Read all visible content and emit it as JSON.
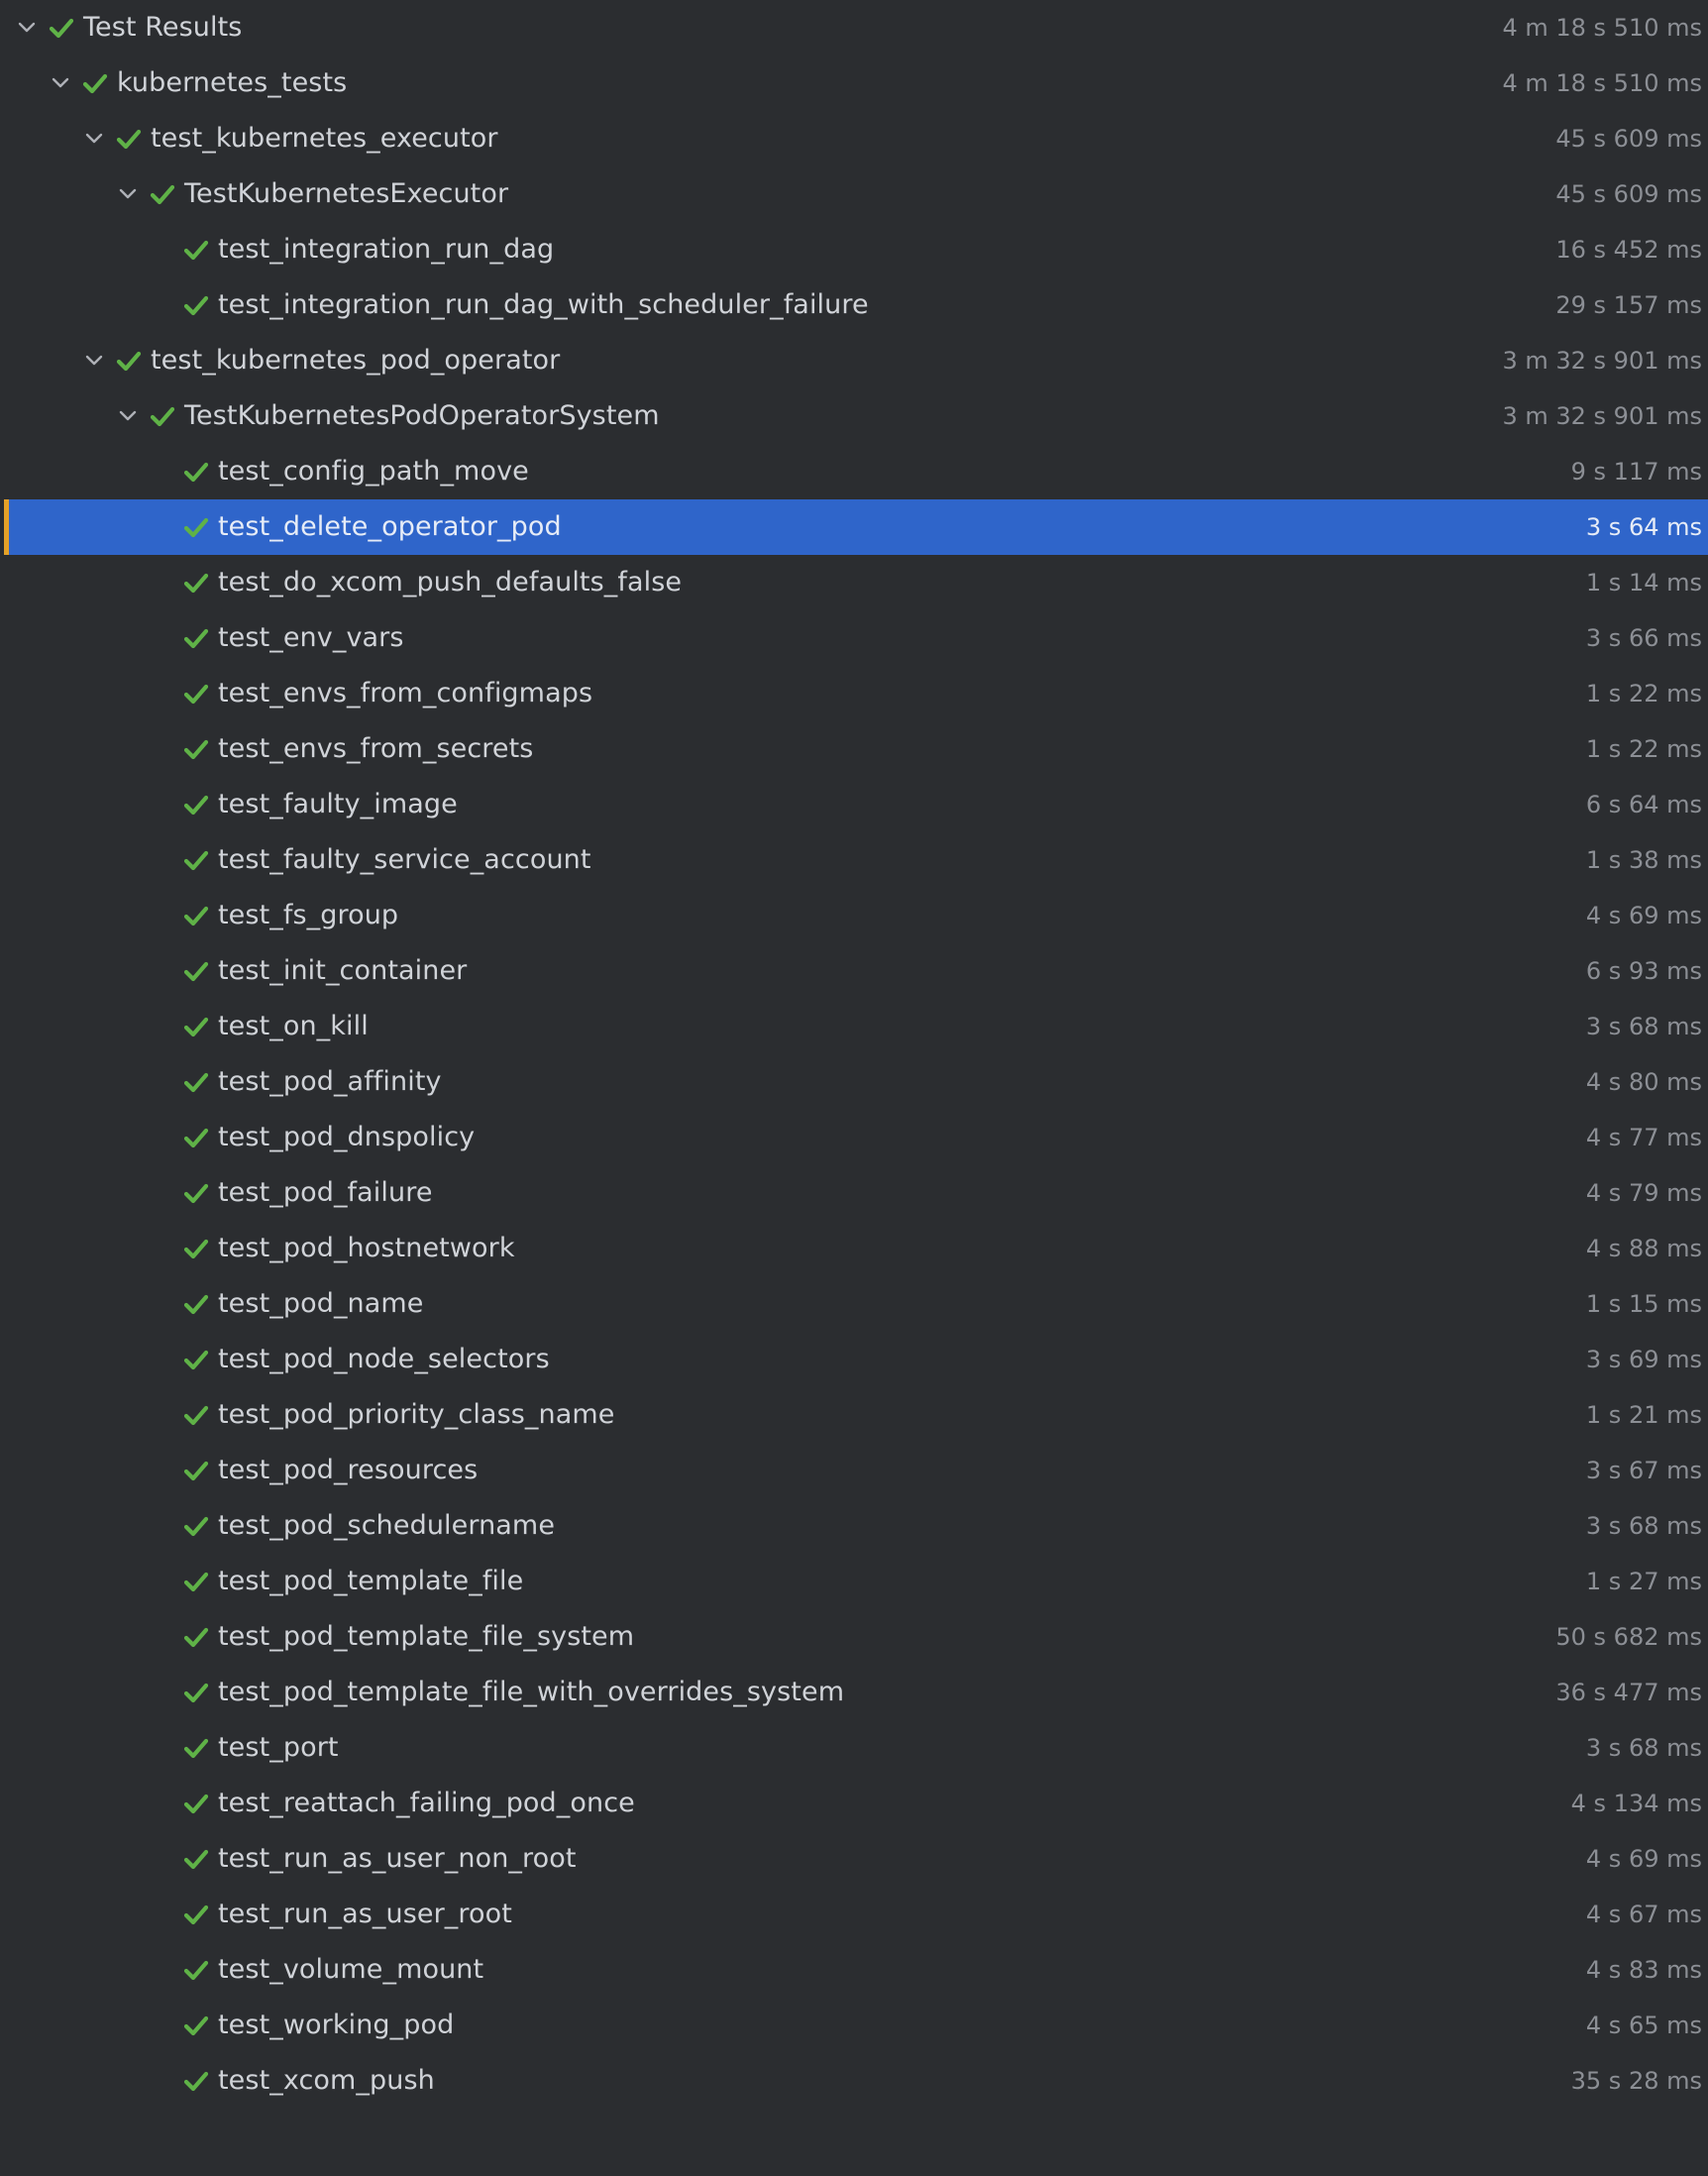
{
  "colors": {
    "background": "#2b2d30",
    "selected_row": "#2f65ca",
    "selected_marker": "#e5a228",
    "pass_check": "#5fb247",
    "text": "#d0d3d8",
    "duration_text": "#8c8f95"
  },
  "icons": {
    "expand": "chevron-down-icon",
    "status": "check-icon"
  },
  "tree": [
    {
      "label": "Test Results",
      "duration": "4 m 18 s 510 ms",
      "level": 0,
      "expanded": true,
      "selected": false,
      "status": "passed"
    },
    {
      "label": "kubernetes_tests",
      "duration": "4 m 18 s 510 ms",
      "level": 1,
      "expanded": true,
      "selected": false,
      "status": "passed"
    },
    {
      "label": "test_kubernetes_executor",
      "duration": "45 s 609 ms",
      "level": 2,
      "expanded": true,
      "selected": false,
      "status": "passed"
    },
    {
      "label": "TestKubernetesExecutor",
      "duration": "45 s 609 ms",
      "level": 3,
      "expanded": true,
      "selected": false,
      "status": "passed"
    },
    {
      "label": "test_integration_run_dag",
      "duration": "16 s 452 ms",
      "level": 4,
      "expanded": null,
      "selected": false,
      "status": "passed"
    },
    {
      "label": "test_integration_run_dag_with_scheduler_failure",
      "duration": "29 s 157 ms",
      "level": 4,
      "expanded": null,
      "selected": false,
      "status": "passed"
    },
    {
      "label": "test_kubernetes_pod_operator",
      "duration": "3 m 32 s 901 ms",
      "level": 2,
      "expanded": true,
      "selected": false,
      "status": "passed"
    },
    {
      "label": "TestKubernetesPodOperatorSystem",
      "duration": "3 m 32 s 901 ms",
      "level": 3,
      "expanded": true,
      "selected": false,
      "status": "passed"
    },
    {
      "label": "test_config_path_move",
      "duration": "9 s 117 ms",
      "level": 4,
      "expanded": null,
      "selected": false,
      "status": "passed"
    },
    {
      "label": "test_delete_operator_pod",
      "duration": "3 s 64 ms",
      "level": 4,
      "expanded": null,
      "selected": true,
      "status": "passed"
    },
    {
      "label": "test_do_xcom_push_defaults_false",
      "duration": "1 s 14 ms",
      "level": 4,
      "expanded": null,
      "selected": false,
      "status": "passed"
    },
    {
      "label": "test_env_vars",
      "duration": "3 s 66 ms",
      "level": 4,
      "expanded": null,
      "selected": false,
      "status": "passed"
    },
    {
      "label": "test_envs_from_configmaps",
      "duration": "1 s 22 ms",
      "level": 4,
      "expanded": null,
      "selected": false,
      "status": "passed"
    },
    {
      "label": "test_envs_from_secrets",
      "duration": "1 s 22 ms",
      "level": 4,
      "expanded": null,
      "selected": false,
      "status": "passed"
    },
    {
      "label": "test_faulty_image",
      "duration": "6 s 64 ms",
      "level": 4,
      "expanded": null,
      "selected": false,
      "status": "passed"
    },
    {
      "label": "test_faulty_service_account",
      "duration": "1 s 38 ms",
      "level": 4,
      "expanded": null,
      "selected": false,
      "status": "passed"
    },
    {
      "label": "test_fs_group",
      "duration": "4 s 69 ms",
      "level": 4,
      "expanded": null,
      "selected": false,
      "status": "passed"
    },
    {
      "label": "test_init_container",
      "duration": "6 s 93 ms",
      "level": 4,
      "expanded": null,
      "selected": false,
      "status": "passed"
    },
    {
      "label": "test_on_kill",
      "duration": "3 s 68 ms",
      "level": 4,
      "expanded": null,
      "selected": false,
      "status": "passed"
    },
    {
      "label": "test_pod_affinity",
      "duration": "4 s 80 ms",
      "level": 4,
      "expanded": null,
      "selected": false,
      "status": "passed"
    },
    {
      "label": "test_pod_dnspolicy",
      "duration": "4 s 77 ms",
      "level": 4,
      "expanded": null,
      "selected": false,
      "status": "passed"
    },
    {
      "label": "test_pod_failure",
      "duration": "4 s 79 ms",
      "level": 4,
      "expanded": null,
      "selected": false,
      "status": "passed"
    },
    {
      "label": "test_pod_hostnetwork",
      "duration": "4 s 88 ms",
      "level": 4,
      "expanded": null,
      "selected": false,
      "status": "passed"
    },
    {
      "label": "test_pod_name",
      "duration": "1 s 15 ms",
      "level": 4,
      "expanded": null,
      "selected": false,
      "status": "passed"
    },
    {
      "label": "test_pod_node_selectors",
      "duration": "3 s 69 ms",
      "level": 4,
      "expanded": null,
      "selected": false,
      "status": "passed"
    },
    {
      "label": "test_pod_priority_class_name",
      "duration": "1 s 21 ms",
      "level": 4,
      "expanded": null,
      "selected": false,
      "status": "passed"
    },
    {
      "label": "test_pod_resources",
      "duration": "3 s 67 ms",
      "level": 4,
      "expanded": null,
      "selected": false,
      "status": "passed"
    },
    {
      "label": "test_pod_schedulername",
      "duration": "3 s 68 ms",
      "level": 4,
      "expanded": null,
      "selected": false,
      "status": "passed"
    },
    {
      "label": "test_pod_template_file",
      "duration": "1 s 27 ms",
      "level": 4,
      "expanded": null,
      "selected": false,
      "status": "passed"
    },
    {
      "label": "test_pod_template_file_system",
      "duration": "50 s 682 ms",
      "level": 4,
      "expanded": null,
      "selected": false,
      "status": "passed"
    },
    {
      "label": "test_pod_template_file_with_overrides_system",
      "duration": "36 s 477 ms",
      "level": 4,
      "expanded": null,
      "selected": false,
      "status": "passed"
    },
    {
      "label": "test_port",
      "duration": "3 s 68 ms",
      "level": 4,
      "expanded": null,
      "selected": false,
      "status": "passed"
    },
    {
      "label": "test_reattach_failing_pod_once",
      "duration": "4 s 134 ms",
      "level": 4,
      "expanded": null,
      "selected": false,
      "status": "passed"
    },
    {
      "label": "test_run_as_user_non_root",
      "duration": "4 s 69 ms",
      "level": 4,
      "expanded": null,
      "selected": false,
      "status": "passed"
    },
    {
      "label": "test_run_as_user_root",
      "duration": "4 s 67 ms",
      "level": 4,
      "expanded": null,
      "selected": false,
      "status": "passed"
    },
    {
      "label": "test_volume_mount",
      "duration": "4 s 83 ms",
      "level": 4,
      "expanded": null,
      "selected": false,
      "status": "passed"
    },
    {
      "label": "test_working_pod",
      "duration": "4 s 65 ms",
      "level": 4,
      "expanded": null,
      "selected": false,
      "status": "passed"
    },
    {
      "label": "test_xcom_push",
      "duration": "35 s 28 ms",
      "level": 4,
      "expanded": null,
      "selected": false,
      "status": "passed"
    }
  ]
}
